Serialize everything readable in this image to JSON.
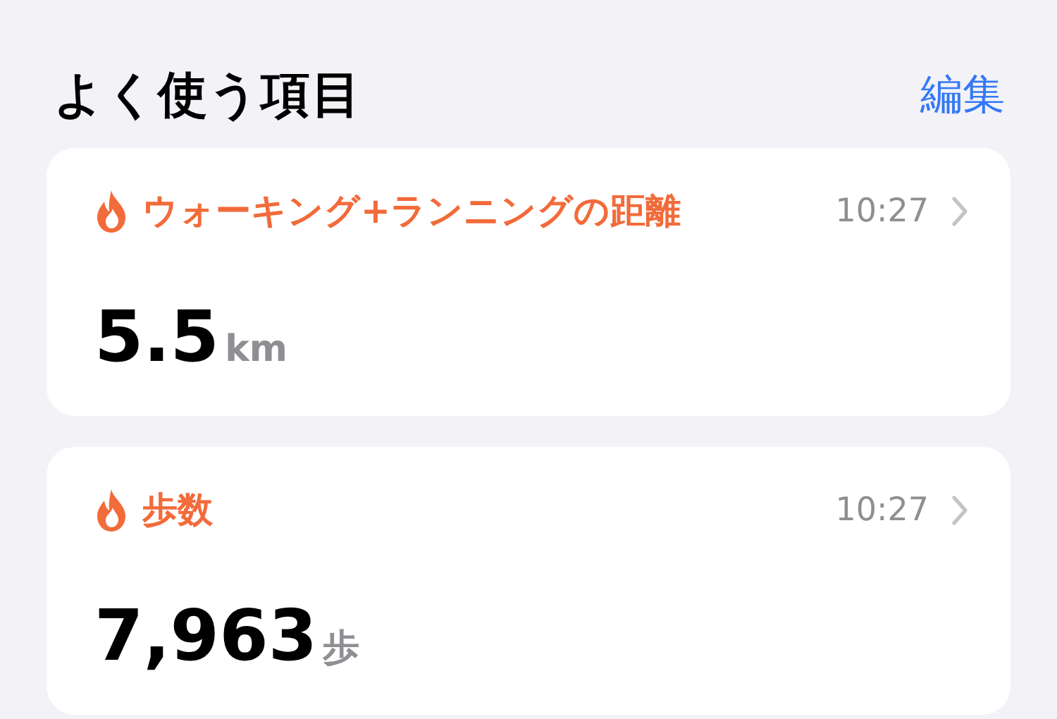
{
  "header": {
    "title": "よく使う項目",
    "edit_link": "編集"
  },
  "cards": [
    {
      "label": "ウォーキング+ランニングの距離",
      "time": "10:27",
      "value": "5.5",
      "unit": "km"
    },
    {
      "label": "歩数",
      "time": "10:27",
      "value": "7,963",
      "unit": "歩"
    }
  ]
}
